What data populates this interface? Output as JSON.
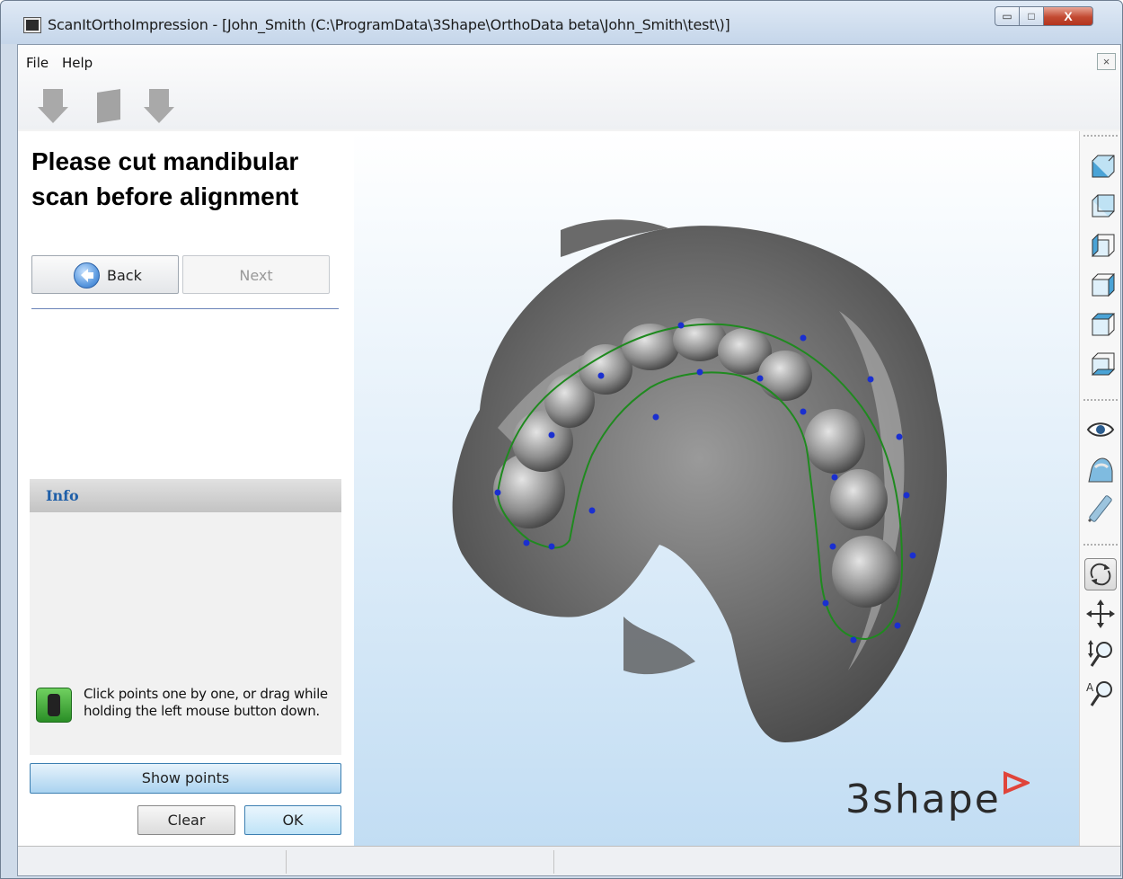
{
  "window": {
    "title": "ScanItOrthoImpression - [John_Smith (C:\\ProgramData\\3Shape\\OrthoData beta\\John_Smith\\test\\)]",
    "minimize_glyph": "▭",
    "maximize_glyph": "□",
    "close_glyph": "X",
    "doc_close_glyph": "×"
  },
  "menu": {
    "file": "File",
    "help": "Help"
  },
  "toolbar": {
    "icons": [
      "arrow-down-icon",
      "page-icon",
      "arrow-down-icon"
    ]
  },
  "wizard": {
    "heading": "Please cut mandibular scan before alignment",
    "back_label": "Back",
    "next_label": "Next"
  },
  "info": {
    "title": "Info",
    "hint": "Click points one by one, or drag while holding the left mouse button down."
  },
  "actions": {
    "show_points": "Show points",
    "clear": "Clear",
    "ok": "OK"
  },
  "viewport": {
    "logo": "3shape"
  },
  "right_toolbar": {
    "view_icons": [
      "view-front-icon",
      "view-back-icon",
      "view-left-icon",
      "view-right-icon",
      "view-top-icon",
      "view-bottom-icon"
    ],
    "tool_icons": [
      "eye-icon",
      "model-icon",
      "pen-icon"
    ],
    "nav_icons": [
      "rotate-icon",
      "pan-icon",
      "zoom-icon",
      "zoom-fit-icon"
    ]
  },
  "colors": {
    "accent": "#2e6fc4",
    "spline": "#1f8a1f",
    "spline_points": "#1a2fd0",
    "logo_triangle": "#e0443a"
  }
}
